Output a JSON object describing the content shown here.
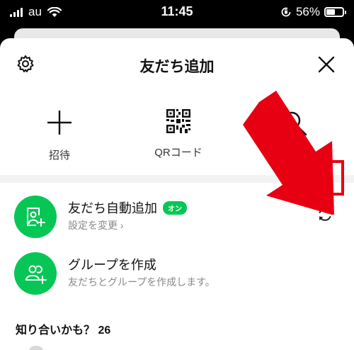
{
  "status_bar": {
    "carrier": "au",
    "time": "11:45",
    "battery": "56%",
    "battery_level": 0.56
  },
  "header": {
    "title": "友だち追加",
    "left_icon": "gear-icon",
    "right_icon": "close-icon"
  },
  "actions": [
    {
      "label": "招待",
      "icon": "plus-icon"
    },
    {
      "label": "QRコード",
      "icon": "qr-code-icon"
    },
    {
      "label": "",
      "icon": "search-icon"
    }
  ],
  "auto_add": {
    "title": "友だち自動追加",
    "badge": "オン",
    "subtitle": "設定を変更",
    "chevron": "›",
    "icon": "refresh-icon"
  },
  "create_group": {
    "title": "グループを作成",
    "subtitle": "友だちとグループを作成します。"
  },
  "suggestions": {
    "title": "知り合いかも？ 26"
  },
  "colors": {
    "accent_green": "#06c755",
    "annotation_red": "#e60012",
    "divider": "#f3f3f3"
  }
}
